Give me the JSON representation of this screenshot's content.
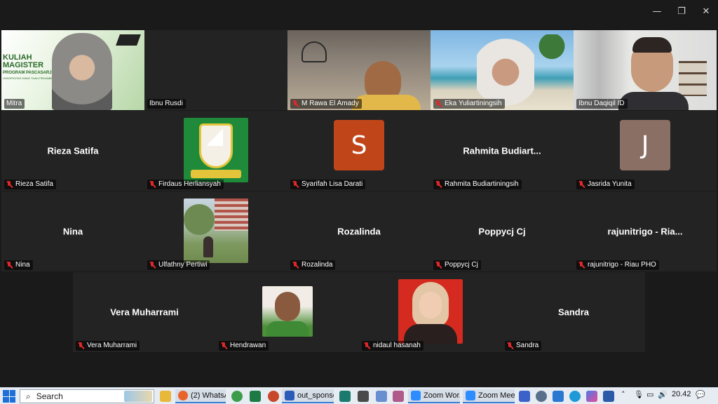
{
  "window": {
    "min_glyph": "—",
    "max_glyph": "❐",
    "close_glyph": "✕"
  },
  "tiles": {
    "mitra": {
      "name": "Mitra",
      "slide_title1": "KULIAH",
      "slide_title2": "MAGISTER",
      "slide_sub": "PROGRAM PASCASARJANA",
      "slide_sub2": "UNIVERSITAS HANG TUAH PEKANBARU"
    },
    "ibnu_rusdi": {
      "name": "Ibnu Rusdi"
    },
    "rawa": {
      "name": "M Rawa El Amady"
    },
    "eka": {
      "name": "Eka Yuliartiningsih"
    },
    "ibnu_daqiqil": {
      "name": "Ibnu Daqiqil ID"
    },
    "rieza": {
      "display": "Rieza Satifa",
      "name": "Rieza Satifa"
    },
    "firdaus": {
      "name": "Firdaus Herliansyah"
    },
    "syarifah": {
      "initial": "S",
      "name": "Syarifah Lisa Darati"
    },
    "rahmita": {
      "display": "Rahmita Budiart...",
      "name": "Rahmita Budiartiningsih"
    },
    "jasrida": {
      "initial": "J",
      "name": "Jasrida Yunita"
    },
    "nina": {
      "display": "Nina",
      "name": "Nina"
    },
    "ulfathny": {
      "name": "Ulfathny Pertiwi"
    },
    "rozalinda": {
      "display": "Rozalinda",
      "name": "Rozalinda"
    },
    "poppycj": {
      "display": "Poppycj Cj",
      "name": "Poppycj Cj"
    },
    "rajunitrigo": {
      "display": "rajunitrigo - Ria...",
      "name": "rajunitrigo - Riau PHO"
    },
    "vera": {
      "display": "Vera Muharrami",
      "name": "Vera Muharrami"
    },
    "hendrawan": {
      "name": "Hendrawan"
    },
    "nidaul": {
      "name": "nidaul hasanah"
    },
    "sandra": {
      "display": "Sandra",
      "name": "Sandra"
    }
  },
  "colors": {
    "syarifah_avatar": "#c0461a",
    "jasrida_avatar": "#8a6f64",
    "active_border": "#2ecc71"
  },
  "taskbar": {
    "search_placeholder": "Search",
    "apps": [
      "(2) WhatsA...",
      "out_sponso...",
      "Zoom Wor...",
      "Zoom Mee..."
    ],
    "time": "20.42"
  }
}
